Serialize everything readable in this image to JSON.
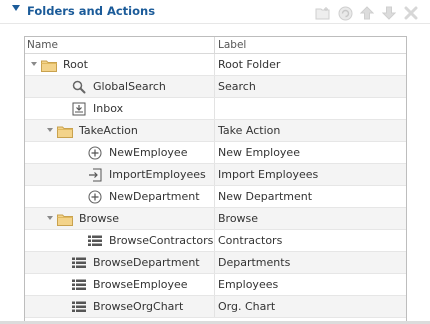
{
  "header": {
    "title": "Folders and Actions"
  },
  "toolbar": {
    "icons": [
      "new-folder-icon",
      "refresh-icon",
      "move-up-icon",
      "move-down-icon",
      "delete-icon"
    ]
  },
  "grid": {
    "columns": {
      "name": "Name",
      "label": "Label"
    },
    "rows": [
      {
        "name": "Root",
        "label": "Root Folder",
        "icon": "folder-icon",
        "level": 0,
        "expandable": true
      },
      {
        "name": "GlobalSearch",
        "label": "Search",
        "icon": "search-icon",
        "level": 1,
        "expandable": false
      },
      {
        "name": "Inbox",
        "label": "",
        "icon": "inbox-icon",
        "level": 1,
        "expandable": false
      },
      {
        "name": "TakeAction",
        "label": "Take Action",
        "icon": "folder-icon",
        "level": 1,
        "expandable": true
      },
      {
        "name": "NewEmployee",
        "label": "New Employee",
        "icon": "plus-circle-icon",
        "level": 2,
        "expandable": false
      },
      {
        "name": "ImportEmployees",
        "label": "Import Employees",
        "icon": "import-icon",
        "level": 2,
        "expandable": false
      },
      {
        "name": "NewDepartment",
        "label": "New Department",
        "icon": "plus-circle-icon",
        "level": 2,
        "expandable": false
      },
      {
        "name": "Browse",
        "label": "Browse",
        "icon": "folder-icon",
        "level": 1,
        "expandable": true
      },
      {
        "name": "BrowseContractors",
        "label": "Contractors",
        "icon": "list-icon",
        "level": 2,
        "expandable": false
      },
      {
        "name": "BrowseDepartment",
        "label": "Departments",
        "icon": "list-icon",
        "level": 1,
        "expandable": false
      },
      {
        "name": "BrowseEmployee",
        "label": "Employees",
        "icon": "list-icon",
        "level": 1,
        "expandable": false
      },
      {
        "name": "BrowseOrgChart",
        "label": "Org. Chart",
        "icon": "list-icon",
        "level": 1,
        "expandable": false
      }
    ]
  },
  "colors": {
    "title": "#1b5b99",
    "folder": "#f3d38a",
    "alt_row": "#f4f4f4"
  }
}
